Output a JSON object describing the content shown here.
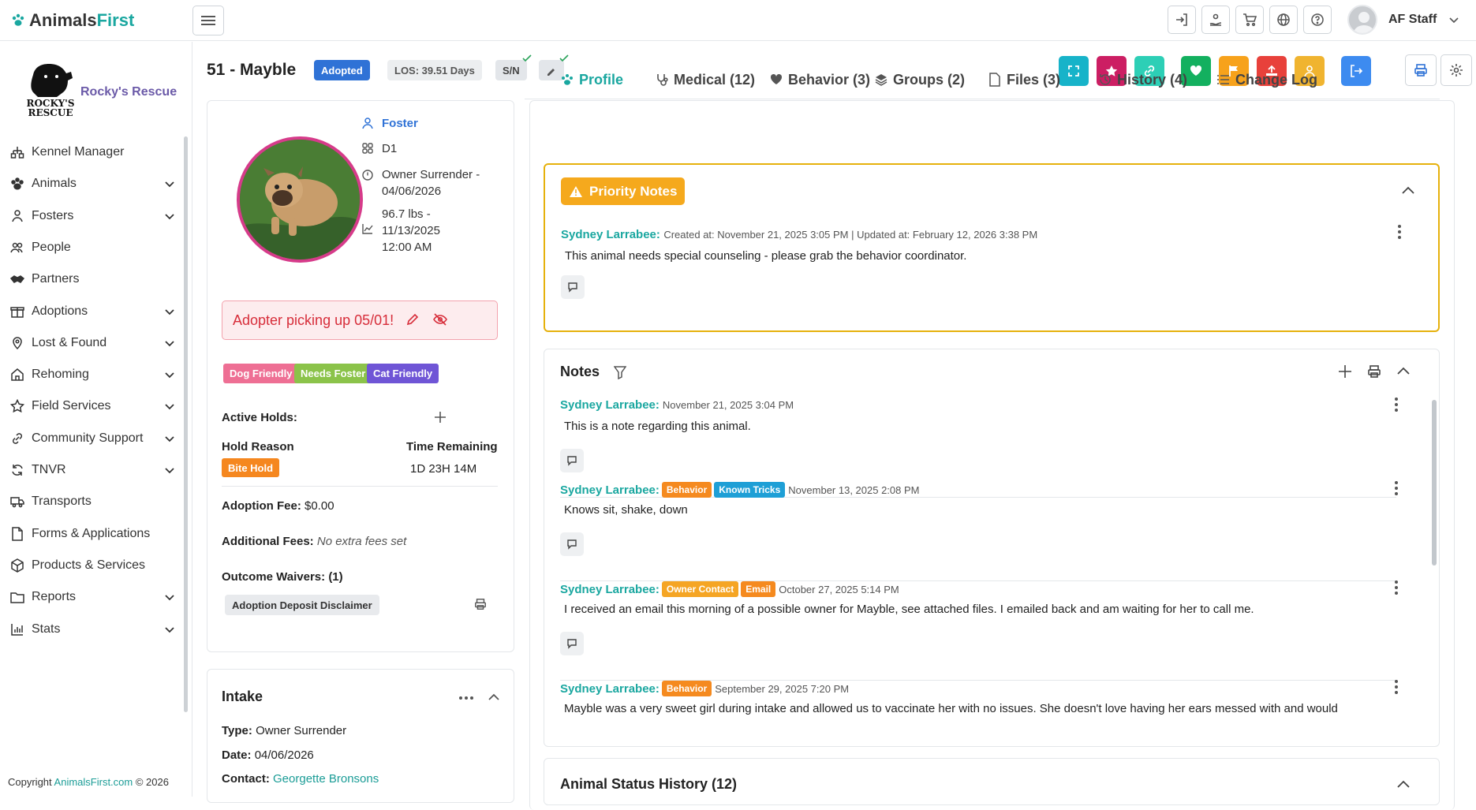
{
  "app": {
    "logo_part1": "Animals",
    "logo_part2": "First",
    "user_name": "AF Staff"
  },
  "org": {
    "name": "Rocky's Rescue",
    "logo_text_1": "ROCKY'S",
    "logo_text_2": "RESCUE"
  },
  "sidebar": {
    "items": [
      {
        "label": "Kennel Manager",
        "icon": "kennel-icon",
        "expandable": false
      },
      {
        "label": "Animals",
        "icon": "paw-icon",
        "expandable": true
      },
      {
        "label": "Fosters",
        "icon": "person-icon",
        "expandable": true
      },
      {
        "label": "People",
        "icon": "people-icon",
        "expandable": false
      },
      {
        "label": "Partners",
        "icon": "handshake-icon",
        "expandable": false
      },
      {
        "label": "Adoptions",
        "icon": "gift-icon",
        "expandable": true
      },
      {
        "label": "Lost & Found",
        "icon": "map-pin-icon",
        "expandable": true
      },
      {
        "label": "Rehoming",
        "icon": "home-icon",
        "expandable": true
      },
      {
        "label": "Field Services",
        "icon": "star-icon",
        "expandable": true
      },
      {
        "label": "Community Support",
        "icon": "link-icon",
        "expandable": true
      },
      {
        "label": "TNVR",
        "icon": "refresh-icon",
        "expandable": true
      },
      {
        "label": "Transports",
        "icon": "truck-icon",
        "expandable": false
      },
      {
        "label": "Forms & Applications",
        "icon": "document-icon",
        "expandable": false
      },
      {
        "label": "Products & Services",
        "icon": "box-icon",
        "expandable": false
      },
      {
        "label": "Reports",
        "icon": "folder-icon",
        "expandable": true
      },
      {
        "label": "Stats",
        "icon": "chart-icon",
        "expandable": true
      }
    ],
    "copyright_prefix": "Copyright ",
    "copyright_link": "AnimalsFirst.com",
    "copyright_suffix": " © 2026"
  },
  "animal": {
    "title": "51 - Mayble",
    "status_badge": "Adopted",
    "los_badge": "LOS: 39.51 Days",
    "sn_badge": "S/N",
    "foster_label": "Foster",
    "kennel": "D1",
    "intake_line1": "Owner Surrender -",
    "intake_line2": "04/06/2026",
    "weight_line1": "96.7 lbs -",
    "weight_line2": "11/13/2025",
    "weight_line3": "12:00 AM",
    "alert_text": "Adopter picking up 05/01!",
    "tags": [
      {
        "label": "Dog Friendly",
        "color": "#ee6f94"
      },
      {
        "label": "Needs Foster",
        "color": "#8bc34a"
      },
      {
        "label": "Cat Friendly",
        "color": "#6f55d6"
      }
    ],
    "active_holds_label": "Active Holds:",
    "hold_reason_label": "Hold Reason",
    "time_remaining_label": "Time Remaining",
    "hold_badge": "Bite Hold",
    "time_remaining": "1D 23H 14M",
    "adoption_fee_label": "Adoption Fee:",
    "adoption_fee": "$0.00",
    "additional_fees_label": "Additional Fees:",
    "additional_fees": "No extra fees set",
    "waivers_label": "Outcome Waivers: (1)",
    "waiver_chip": "Adoption Deposit Disclaimer"
  },
  "intake": {
    "title": "Intake",
    "type_label": "Type:",
    "type": "Owner Surrender",
    "date_label": "Date:",
    "date": "04/06/2026",
    "contact_label": "Contact:",
    "contact": "Georgette Bronsons"
  },
  "action_buttons": [
    {
      "icon": "resize-icon",
      "color": "#17b3c9"
    },
    {
      "icon": "star-icon",
      "color": "#cc1e63"
    },
    {
      "icon": "link-icon",
      "color": "#2dcfb6"
    },
    {
      "icon": "heart-icon",
      "color": "#13b05f"
    },
    {
      "icon": "flag-icon",
      "color": "#f7a21b"
    },
    {
      "icon": "upload-icon",
      "color": "#e8413b"
    },
    {
      "icon": "user-icon",
      "color": "#f0b430"
    },
    {
      "icon": "exit-icon",
      "color": "#3d8bf0"
    }
  ],
  "tabs": [
    {
      "label": "Profile",
      "icon": "paw-icon"
    },
    {
      "label": "Medical (12)",
      "icon": "stethoscope-icon"
    },
    {
      "label": "Behavior (3)",
      "icon": "heart-paw-icon"
    },
    {
      "label": "Groups (2)",
      "icon": "layers-icon"
    },
    {
      "label": "Files (3)",
      "icon": "file-icon"
    },
    {
      "label": "History (4)",
      "icon": "history-icon"
    },
    {
      "label": "Change Log",
      "icon": "list-icon"
    }
  ],
  "priority_notes": {
    "title": "Priority Notes",
    "author": "Sydney Larrabee:",
    "meta": "Created at: November 21, 2025 3:05 PM | Updated at: February 12, 2026 3:38 PM",
    "body": "This animal needs special counseling - please grab the behavior coordinator."
  },
  "notes": {
    "title": "Notes",
    "items": [
      {
        "author": "Sydney Larrabee:",
        "tags": [],
        "date": "November 21, 2025 3:04 PM",
        "body": "This is a note regarding this animal."
      },
      {
        "author": "Sydney Larrabee:",
        "tags": [
          {
            "label": "Behavior",
            "color": "#f58a1f"
          },
          {
            "label": "Known Tricks",
            "color": "#1e9fd6"
          }
        ],
        "date": "November 13, 2025 2:08 PM",
        "body": "Knows sit, shake, down"
      },
      {
        "author": "Sydney Larrabee:",
        "tags": [
          {
            "label": "Owner Contact",
            "color": "#f5a524"
          },
          {
            "label": "Email",
            "color": "#f58a1f"
          }
        ],
        "date": "October 27, 2025 5:14 PM",
        "body": "I received an email this morning of a possible owner for Mayble, see attached files. I emailed back and am waiting for her to call me."
      },
      {
        "author": "Sydney Larrabee:",
        "tags": [
          {
            "label": "Behavior",
            "color": "#f58a1f"
          }
        ],
        "date": "September 29, 2025 7:20 PM",
        "body": "Mayble was a very sweet girl during intake and allowed us to vaccinate her with no issues. She doesn't love having her ears messed with and would"
      }
    ]
  },
  "status_history": {
    "title": "Animal Status History (12)"
  }
}
